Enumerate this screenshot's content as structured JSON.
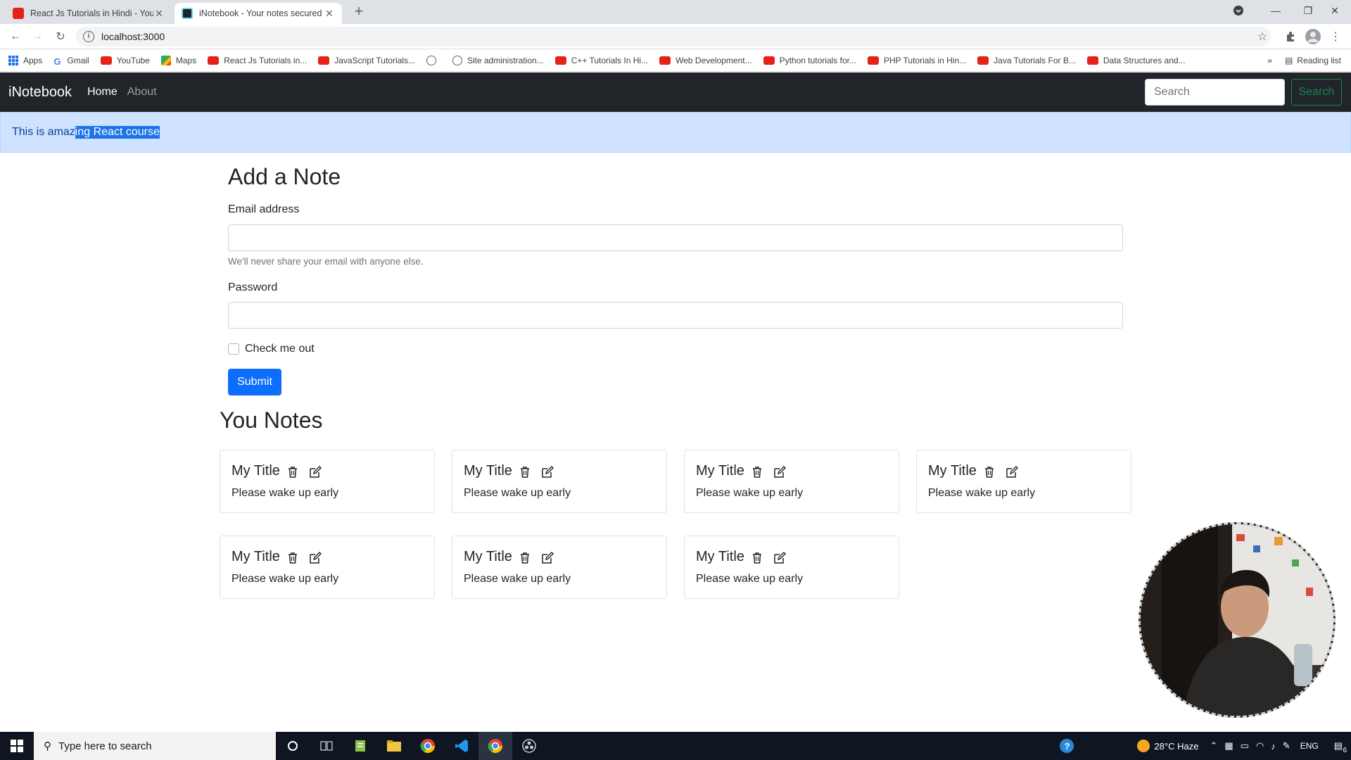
{
  "browser": {
    "tabs": [
      {
        "title": "React Js Tutorials in Hindi - YouTube",
        "favicon_color": "#e62117",
        "active": false
      },
      {
        "title": "iNotebook - Your notes secured",
        "favicon_color": "#20232a",
        "active": true
      }
    ],
    "url": "localhost:3000",
    "bookmarks": [
      {
        "label": "Apps",
        "icon": "apps-icon"
      },
      {
        "label": "Gmail",
        "icon": "google-icon"
      },
      {
        "label": "YouTube",
        "icon": "youtube-icon"
      },
      {
        "label": "Maps",
        "icon": "maps-icon"
      },
      {
        "label": "React Js Tutorials in...",
        "icon": "youtube-icon"
      },
      {
        "label": "JavaScript Tutorials...",
        "icon": "youtube-icon"
      },
      {
        "label": "",
        "icon": "globe-icon"
      },
      {
        "label": "Site administration...",
        "icon": "globe-icon"
      },
      {
        "label": "C++ Tutorials In Hi...",
        "icon": "youtube-icon"
      },
      {
        "label": "Web Development...",
        "icon": "youtube-icon"
      },
      {
        "label": "Python tutorials for...",
        "icon": "youtube-icon"
      },
      {
        "label": "PHP Tutorials in Hin...",
        "icon": "youtube-icon"
      },
      {
        "label": "Java Tutorials For B...",
        "icon": "youtube-icon"
      },
      {
        "label": "Data Structures and...",
        "icon": "youtube-icon"
      }
    ],
    "reading_list": "Reading list"
  },
  "app": {
    "brand": "iNotebook",
    "nav": [
      {
        "label": "Home",
        "active": true
      },
      {
        "label": "About",
        "active": false
      }
    ],
    "search_placeholder": "Search",
    "search_button": "Search",
    "alert": {
      "text_before": "This is amaz",
      "text_selected": "ing React course"
    },
    "form": {
      "heading": "Add a Note",
      "email_label": "Email address",
      "email_value": "",
      "email_help": "We'll never share your email with anyone else.",
      "password_label": "Password",
      "password_value": "",
      "check_label": "Check me out",
      "checked": false,
      "submit": "Submit"
    },
    "notes_heading": "You Notes",
    "notes": [
      {
        "title": "My Title",
        "description": "Please wake up early"
      },
      {
        "title": "My Title",
        "description": "Please wake up early"
      },
      {
        "title": "My Title",
        "description": "Please wake up early"
      },
      {
        "title": "My Title",
        "description": "Please wake up early"
      },
      {
        "title": "My Title",
        "description": "Please wake up early"
      },
      {
        "title": "My Title",
        "description": "Please wake up early"
      },
      {
        "title": "My Title",
        "description": "Please wake up early"
      }
    ]
  },
  "taskbar": {
    "search_placeholder": "Type here to search",
    "weather": "28°C Haze",
    "language": "ENG",
    "notification_count": "6"
  },
  "colors": {
    "navbar": "#212529",
    "alert_bg": "#cfe2ff",
    "primary": "#0d6efd",
    "success": "#198754"
  }
}
